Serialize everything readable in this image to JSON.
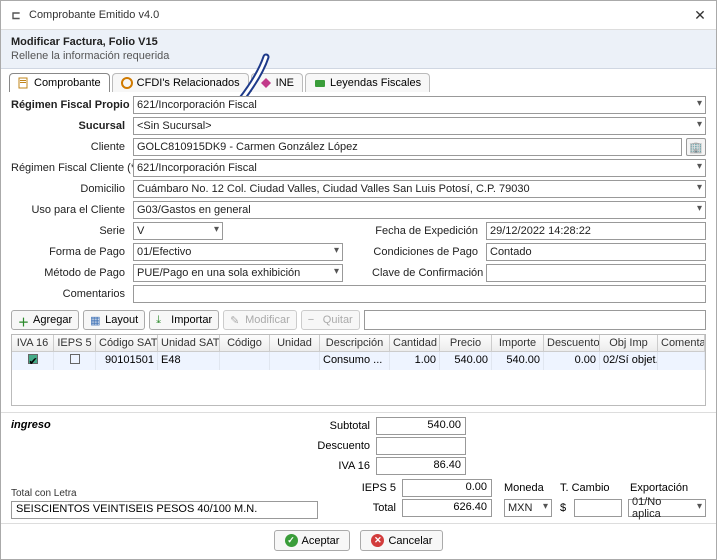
{
  "window": {
    "title": "Comprobante Emitido v4.0"
  },
  "subheader": {
    "title": "Modificar Factura, Folio V15",
    "subtitle": "Rellene la información requerida"
  },
  "tabs": {
    "comprobante": "Comprobante",
    "cfdis": "CFDI's Relacionados",
    "ine": "INE",
    "leyendas": "Leyendas Fiscales"
  },
  "labels": {
    "regimen_propio": "Régimen Fiscal Propio (*)",
    "sucursal": "Sucursal",
    "cliente": "Cliente",
    "regimen_cliente": "Régimen Fiscal Cliente (*)",
    "domicilio": "Domicilio",
    "uso_cliente": "Uso para el Cliente",
    "serie": "Serie",
    "fecha": "Fecha de Expedición",
    "forma_pago": "Forma de Pago",
    "cond_pago": "Condiciones de Pago",
    "metodo_pago": "Método de Pago",
    "clave_conf": "Clave de Confirmación",
    "comentarios": "Comentarios",
    "ingreso": "ingreso",
    "subtotal": "Subtotal",
    "descuento_t": "Descuento",
    "iva16": "IVA 16",
    "ieps5": "IEPS 5",
    "total": "Total",
    "moneda": "Moneda",
    "tcambio": "T. Cambio",
    "exportacion": "Exportación",
    "total_letra": "Total con Letra"
  },
  "fields": {
    "regimen_propio": "621/Incorporación Fiscal",
    "sucursal": "<Sin Sucursal>",
    "cliente": "GOLC810915DK9 - Carmen González López",
    "regimen_cliente": "621/Incorporación Fiscal",
    "domicilio": "Cuámbaro No. 12 Col. Ciudad Valles, Ciudad Valles San Luis Potosí, C.P. 79030",
    "uso_cliente": "G03/Gastos en general",
    "serie": "V",
    "fecha": "29/12/2022 14:28:22",
    "forma_pago": "01/Efectivo",
    "cond_pago": "Contado",
    "metodo_pago": "PUE/Pago en una sola exhibición",
    "clave_conf": "",
    "comentarios": ""
  },
  "toolbar": {
    "agregar": "Agregar",
    "layout": "Layout",
    "importar": "Importar",
    "modificar": "Modificar",
    "quitar": "Quitar"
  },
  "grid": {
    "headers": [
      "IVA 16",
      "IEPS 5",
      "Código SAT",
      "Unidad SAT",
      "Código",
      "Unidad",
      "Descripción",
      "Cantidad",
      "Precio",
      "Importe",
      "Descuento",
      "Obj Imp",
      "Comentari"
    ],
    "row": {
      "iva16": true,
      "ieps5": false,
      "codigo_sat": "90101501",
      "unidad_sat": "E48",
      "codigo": "",
      "unidad": "",
      "descripcion": "Consumo ...",
      "cantidad": "1.00",
      "precio": "540.00",
      "importe": "540.00",
      "descuento": "0.00",
      "objimp": "02/Sí objet...",
      "coment": ""
    }
  },
  "totals": {
    "subtotal": "540.00",
    "descuento": "",
    "iva16": "86.40",
    "ieps5": "0.00",
    "total": "626.40",
    "moneda": "MXN",
    "tcambio_prefix": "$",
    "tcambio": "",
    "exportacion": "01/No aplica",
    "letra": "SEISCIENTOS VEINTISEIS PESOS 40/100 M.N."
  },
  "footer": {
    "aceptar": "Aceptar",
    "cancelar": "Cancelar"
  }
}
